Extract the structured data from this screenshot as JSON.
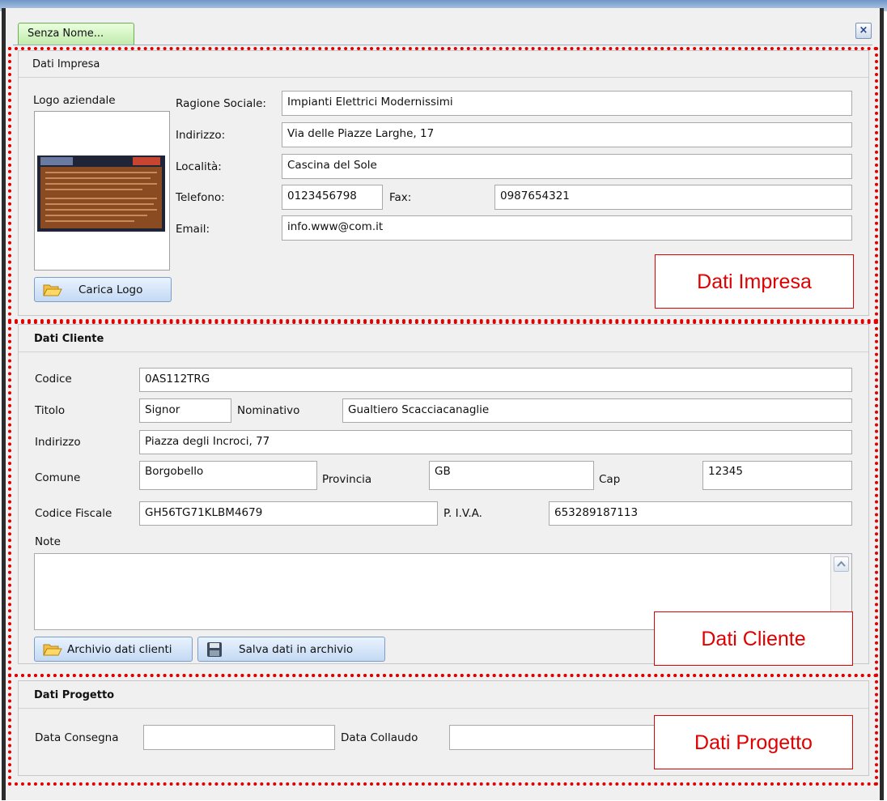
{
  "tab": {
    "title": "Senza Nome...",
    "close_glyph": "×"
  },
  "impresa": {
    "group_title": "Dati Impresa",
    "logo_label": "Logo aziendale",
    "load_logo_button": "Carica Logo",
    "fields": {
      "ragione_sociale": {
        "label": "Ragione Sociale:",
        "value": "Impianti Elettrici Modernissimi"
      },
      "indirizzo": {
        "label": "Indirizzo:",
        "value": "Via delle Piazze Larghe, 17"
      },
      "localita": {
        "label": "Località:",
        "value": "Cascina del Sole"
      },
      "telefono": {
        "label": "Telefono:",
        "value": "0123456798"
      },
      "fax": {
        "label": "Fax:",
        "value": "0987654321"
      },
      "email": {
        "label": "Email:",
        "value": "info.www@com.it"
      }
    },
    "annotation": "Dati Impresa"
  },
  "cliente": {
    "group_title": "Dati Cliente",
    "fields": {
      "codice": {
        "label": "Codice",
        "value": "0AS112TRG"
      },
      "titolo": {
        "label": "Titolo",
        "value": "Signor"
      },
      "nominativo": {
        "label": "Nominativo",
        "value": "Gualtiero Scacciacanaglie"
      },
      "indirizzo": {
        "label": "Indirizzo",
        "value": "Piazza degli Incroci, 77"
      },
      "comune": {
        "label": "Comune",
        "value": "Borgobello"
      },
      "provincia": {
        "label": "Provincia",
        "value": "GB"
      },
      "cap": {
        "label": "Cap",
        "value": "12345"
      },
      "codice_fiscale": {
        "label": "Codice Fiscale",
        "value": "GH56TG71KLBM4679"
      },
      "piva": {
        "label": "P. I.V.A.",
        "value": "653289187113"
      },
      "note": {
        "label": "Note",
        "value": ""
      }
    },
    "archive_button": "Archivio dati clienti",
    "save_button": "Salva dati in archivio",
    "annotation": "Dati Cliente"
  },
  "progetto": {
    "group_title": "Dati Progetto",
    "fields": {
      "data_consegna": {
        "label": "Data Consegna",
        "value": ""
      },
      "data_collaudo": {
        "label": "Data Collaudo",
        "value": ""
      }
    },
    "annotation": "Dati Progetto"
  },
  "colors": {
    "annotation_red": "#e00000",
    "tab_green": "#bfeaa8",
    "button_blue": "#c3d9f3"
  }
}
